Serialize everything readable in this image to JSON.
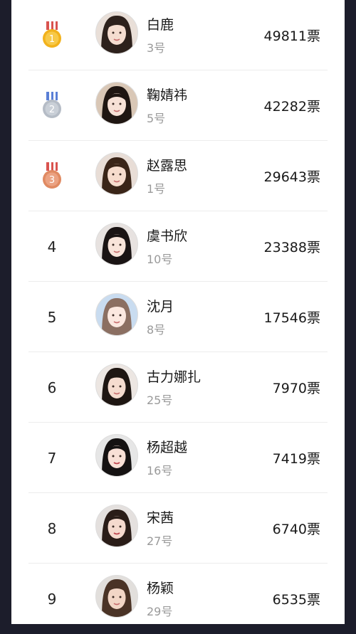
{
  "ranking": [
    {
      "rank": "1",
      "medal": "gold",
      "name": "白鹿",
      "number": "3号",
      "votes": "49811票"
    },
    {
      "rank": "2",
      "medal": "silver",
      "name": "鞠婧祎",
      "number": "5号",
      "votes": "42282票"
    },
    {
      "rank": "3",
      "medal": "bronze",
      "name": "赵露思",
      "number": "1号",
      "votes": "29643票"
    },
    {
      "rank": "4",
      "medal": "",
      "name": "虞书欣",
      "number": "10号",
      "votes": "23388票"
    },
    {
      "rank": "5",
      "medal": "",
      "name": "沈月",
      "number": "8号",
      "votes": "17546票"
    },
    {
      "rank": "6",
      "medal": "",
      "name": "古力娜扎",
      "number": "25号",
      "votes": "7970票"
    },
    {
      "rank": "7",
      "medal": "",
      "name": "杨超越",
      "number": "16号",
      "votes": "7419票"
    },
    {
      "rank": "8",
      "medal": "",
      "name": "宋茜",
      "number": "27号",
      "votes": "6740票"
    },
    {
      "rank": "9",
      "medal": "",
      "name": "杨颖",
      "number": "29号",
      "votes": "6535票"
    }
  ],
  "colors": {
    "gold": "#f2b21c",
    "silver": "#b5bcc6",
    "bronze": "#e08a62",
    "ribbon_red": "#d9534f",
    "ribbon_blue": "#5a7fd6"
  }
}
